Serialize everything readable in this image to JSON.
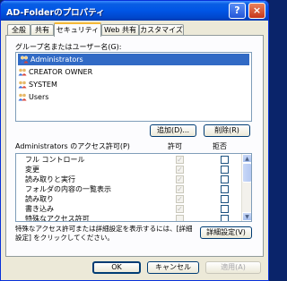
{
  "window": {
    "title": "AD-Folderのプロパティ",
    "help_symbol": "?",
    "close_symbol": "×"
  },
  "tabs": [
    {
      "label": "全般",
      "active": false
    },
    {
      "label": "共有",
      "active": false
    },
    {
      "label": "セキュリティ",
      "active": true
    },
    {
      "label": "Web 共有",
      "active": false
    },
    {
      "label": "カスタマイズ",
      "active": false
    }
  ],
  "security": {
    "group_label": "グループ名またはユーザー名(G):",
    "users": [
      {
        "name": "Administrators",
        "selected": true
      },
      {
        "name": "CREATOR OWNER",
        "selected": false
      },
      {
        "name": "SYSTEM",
        "selected": false
      },
      {
        "name": "Users",
        "selected": false
      }
    ],
    "add_button": "追加(D)...",
    "remove_button": "削除(R)",
    "permissions_label": "Administrators のアクセス許可(P)",
    "allow_header": "許可",
    "deny_header": "拒否",
    "permissions": [
      {
        "name": "フル コントロール",
        "allow": true,
        "deny": false
      },
      {
        "name": "変更",
        "allow": true,
        "deny": false
      },
      {
        "name": "読み取りと実行",
        "allow": true,
        "deny": false
      },
      {
        "name": "フォルダの内容の一覧表示",
        "allow": true,
        "deny": false
      },
      {
        "name": "読み取り",
        "allow": true,
        "deny": false
      },
      {
        "name": "書き込み",
        "allow": true,
        "deny": false
      },
      {
        "name": "特殊なアクセス許可",
        "allow": false,
        "deny": false
      }
    ],
    "advanced_note": "特殊なアクセス許可または詳細設定を表示するには、[詳細設定] をクリックしてください。",
    "advanced_button": "詳細設定(V)"
  },
  "footer": {
    "ok": "OK",
    "cancel": "キャンセル",
    "apply": "適用(A)"
  },
  "colors": {
    "titlebar": "#0055e5",
    "selection": "#316ac5",
    "active_tab_accent": "#f5b835"
  }
}
